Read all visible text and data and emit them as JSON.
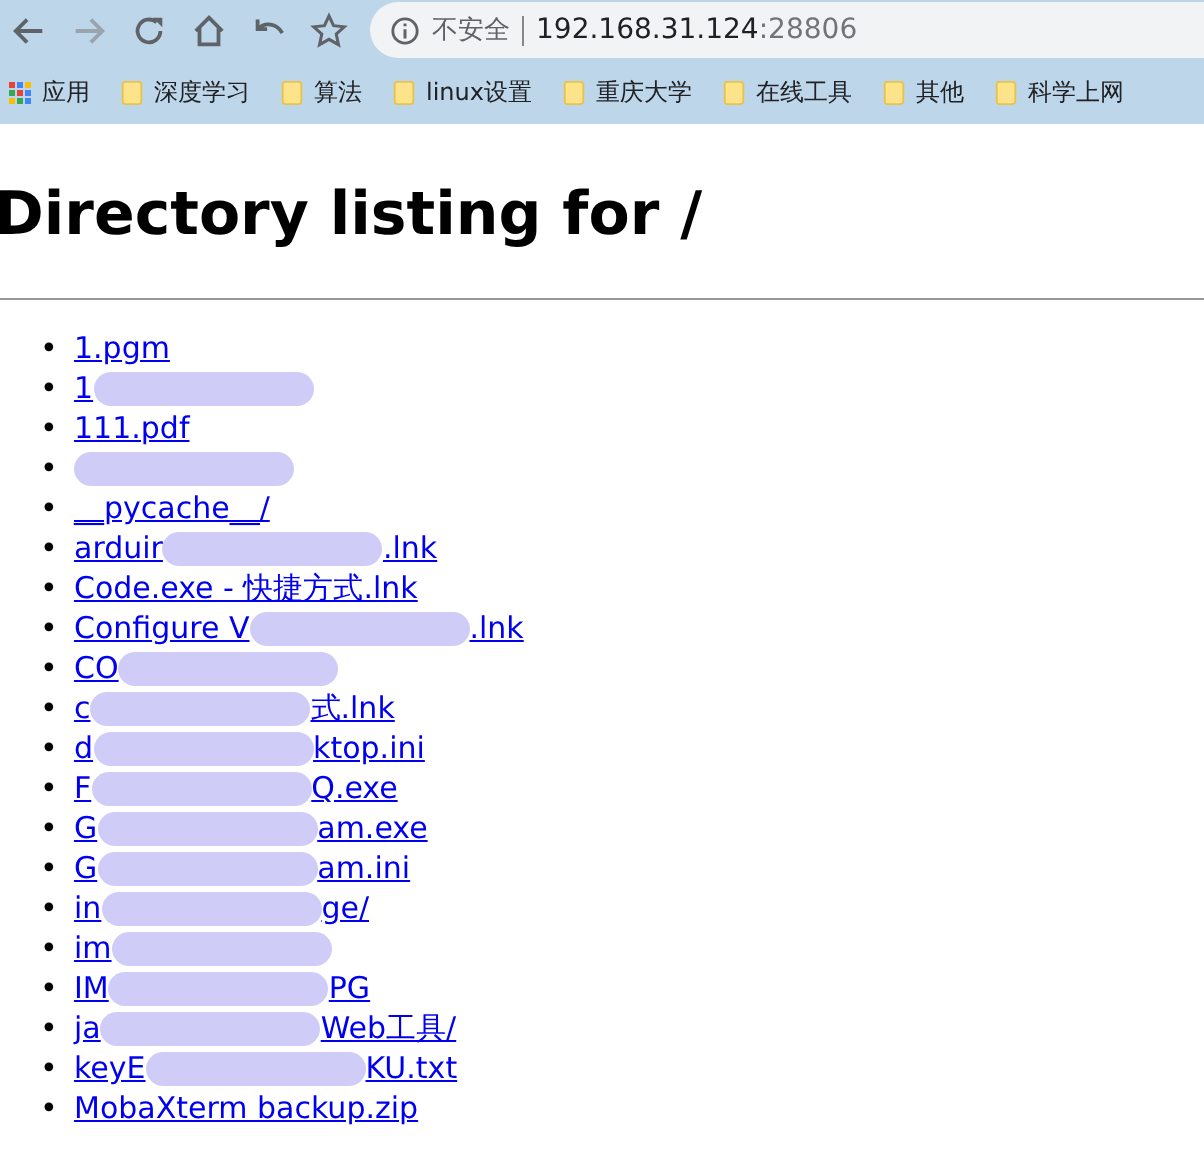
{
  "browser": {
    "security": "不安全",
    "url_host": "192.168.31.124",
    "url_port": ":28806"
  },
  "bookmarks": [
    {
      "label": "应用",
      "kind": "apps"
    },
    {
      "label": "深度学习",
      "kind": "folder"
    },
    {
      "label": "算法",
      "kind": "folder"
    },
    {
      "label": "linux设置",
      "kind": "folder"
    },
    {
      "label": "重庆大学",
      "kind": "folder"
    },
    {
      "label": "在线工具",
      "kind": "folder"
    },
    {
      "label": "其他",
      "kind": "folder"
    },
    {
      "label": "科学上网",
      "kind": "folder"
    }
  ],
  "heading": "Directory listing for /",
  "files": [
    {
      "marker": "•",
      "segments": [
        {
          "kind": "text",
          "text": "1.pgm"
        }
      ]
    },
    {
      "marker": "•",
      "segments": [
        {
          "kind": "text",
          "text": "1"
        },
        {
          "kind": "redacted"
        }
      ]
    },
    {
      "marker": "•",
      "segments": [
        {
          "kind": "text",
          "text": "111.pdf"
        }
      ]
    },
    {
      "marker": "•",
      "segments": [
        {
          "kind": "redacted"
        }
      ]
    },
    {
      "marker": "•",
      "segments": [
        {
          "kind": "text",
          "text": "__pycache__/"
        }
      ]
    },
    {
      "marker": "•",
      "segments": [
        {
          "kind": "text",
          "text": "arduir"
        },
        {
          "kind": "redacted"
        },
        {
          "kind": "text",
          "text": ".lnk"
        }
      ]
    },
    {
      "marker": "•",
      "segments": [
        {
          "kind": "text",
          "text": "Code.exe - 快捷方式.lnk"
        }
      ]
    },
    {
      "marker": "•",
      "segments": [
        {
          "kind": "text",
          "text": "Configure V"
        },
        {
          "kind": "redacted"
        },
        {
          "kind": "text",
          "text": ".lnk"
        }
      ]
    },
    {
      "marker": "•",
      "segments": [
        {
          "kind": "text",
          "text": "CO"
        },
        {
          "kind": "redacted"
        }
      ]
    },
    {
      "marker": "•",
      "segments": [
        {
          "kind": "text",
          "text": "c"
        },
        {
          "kind": "redacted"
        },
        {
          "kind": "text",
          "text": "式.lnk"
        }
      ]
    },
    {
      "marker": "•",
      "segments": [
        {
          "kind": "text",
          "text": "d"
        },
        {
          "kind": "redacted"
        },
        {
          "kind": "text",
          "text": "ktop.ini"
        }
      ]
    },
    {
      "marker": "•",
      "segments": [
        {
          "kind": "text",
          "text": "F"
        },
        {
          "kind": "redacted"
        },
        {
          "kind": "text",
          "text": "Q.exe"
        }
      ]
    },
    {
      "marker": "•",
      "segments": [
        {
          "kind": "text",
          "text": "G"
        },
        {
          "kind": "redacted"
        },
        {
          "kind": "text",
          "text": "am.exe"
        }
      ]
    },
    {
      "marker": "•",
      "segments": [
        {
          "kind": "text",
          "text": "G"
        },
        {
          "kind": "redacted"
        },
        {
          "kind": "text",
          "text": "am.ini"
        }
      ]
    },
    {
      "marker": "•",
      "segments": [
        {
          "kind": "text",
          "text": "in"
        },
        {
          "kind": "redacted"
        },
        {
          "kind": "text",
          "text": "ge/"
        }
      ]
    },
    {
      "marker": "•",
      "segments": [
        {
          "kind": "text",
          "text": "im"
        },
        {
          "kind": "redacted"
        }
      ]
    },
    {
      "marker": "•",
      "segments": [
        {
          "kind": "text",
          "text": "IM"
        },
        {
          "kind": "redacted"
        },
        {
          "kind": "text",
          "text": "PG"
        }
      ]
    },
    {
      "marker": "•",
      "segments": [
        {
          "kind": "text",
          "text": "ja"
        },
        {
          "kind": "redacted"
        },
        {
          "kind": "text",
          "text": "Web工具/"
        }
      ]
    },
    {
      "marker": "•",
      "segments": [
        {
          "kind": "text",
          "text": "keyE"
        },
        {
          "kind": "redacted"
        },
        {
          "kind": "text",
          "text": "KU.txt"
        }
      ]
    },
    {
      "marker": "•",
      "segments": [
        {
          "kind": "text",
          "text": "MobaXterm backup.zip"
        }
      ]
    }
  ]
}
